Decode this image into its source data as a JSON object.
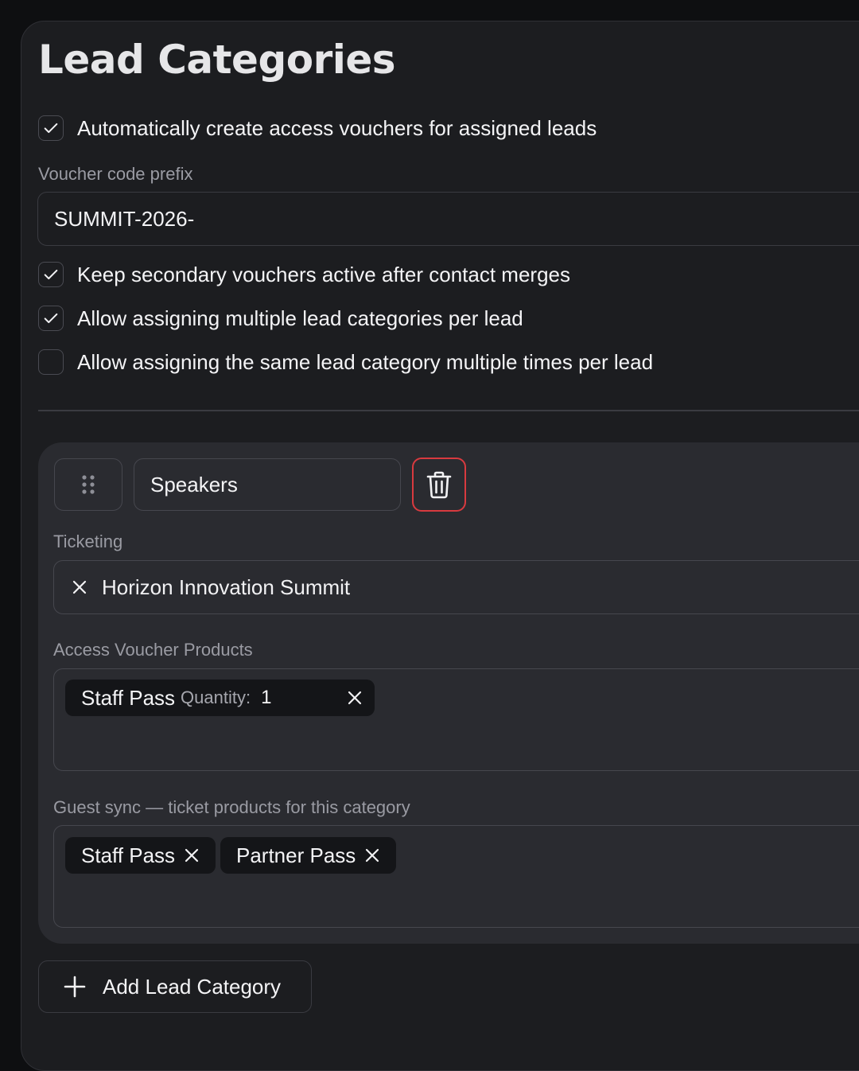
{
  "page": {
    "title": "Lead Categories"
  },
  "settings": {
    "auto_create": {
      "label": "Automatically create access vouchers for assigned leads",
      "checked": true
    },
    "prefix": {
      "label": "Voucher code prefix",
      "value": "SUMMIT-2026-"
    },
    "keep_secondary": {
      "label": "Keep secondary vouchers active after contact merges",
      "checked": true
    },
    "allow_multiple": {
      "label": "Allow assigning multiple lead categories per lead",
      "checked": true
    },
    "allow_same": {
      "label": "Allow assigning the same lead category multiple times per lead",
      "checked": false
    }
  },
  "category": {
    "name": "Speakers",
    "ticketing": {
      "label": "Ticketing",
      "value": "Horizon Innovation Summit"
    },
    "access_products": {
      "label": "Access Voucher Products",
      "items": [
        {
          "name": "Staff Pass",
          "quantity_label": "Quantity:",
          "quantity": "1"
        }
      ]
    },
    "guest_sync": {
      "label": "Guest sync — ticket products for this category",
      "items": [
        {
          "name": "Staff Pass"
        },
        {
          "name": "Partner Pass"
        }
      ]
    }
  },
  "actions": {
    "add_label": "Add Lead Category"
  },
  "icons": {
    "check": "check-icon",
    "drag": "drag-handle-icon",
    "delete": "trash-icon",
    "remove": "close-icon",
    "add": "plus-icon"
  },
  "colors": {
    "danger": "#d83a3f",
    "panel": "#1c1d20",
    "card": "#2a2b30",
    "chip": "#141518"
  }
}
